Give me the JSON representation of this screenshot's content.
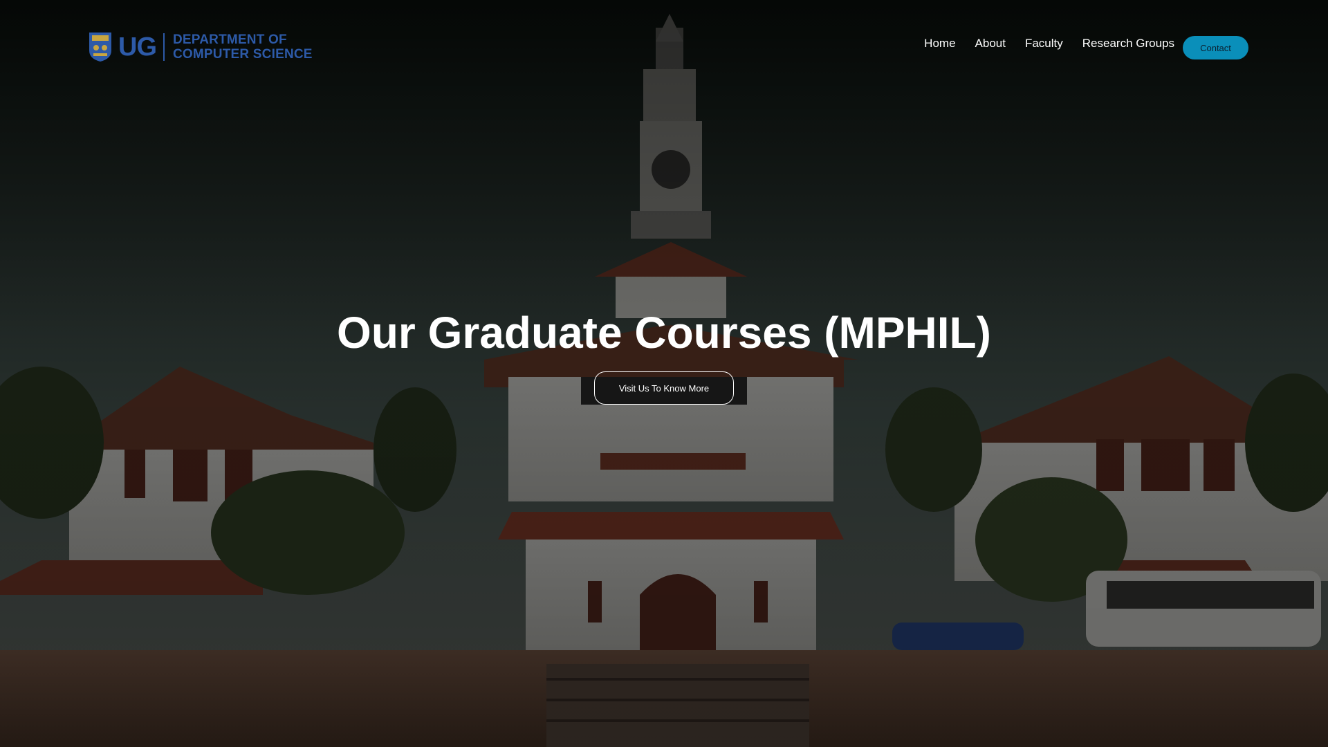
{
  "header": {
    "logo": {
      "ug": "UG",
      "dept_line1": "DEPARTMENT OF",
      "dept_line2": "COMPUTER SCIENCE"
    },
    "nav": [
      {
        "label": "Home"
      },
      {
        "label": "About"
      },
      {
        "label": "Faculty"
      },
      {
        "label": "Research Groups"
      }
    ],
    "contact_label": "Contact"
  },
  "hero": {
    "title": "Our Graduate Courses (MPHIL)",
    "cta_label": "Visit Us To Know More"
  },
  "colors": {
    "brand_blue": "#2d5aa8",
    "contact_button": "#0a8fba",
    "text": "#ffffff"
  },
  "icons": {
    "logo": "university-crest-icon"
  }
}
